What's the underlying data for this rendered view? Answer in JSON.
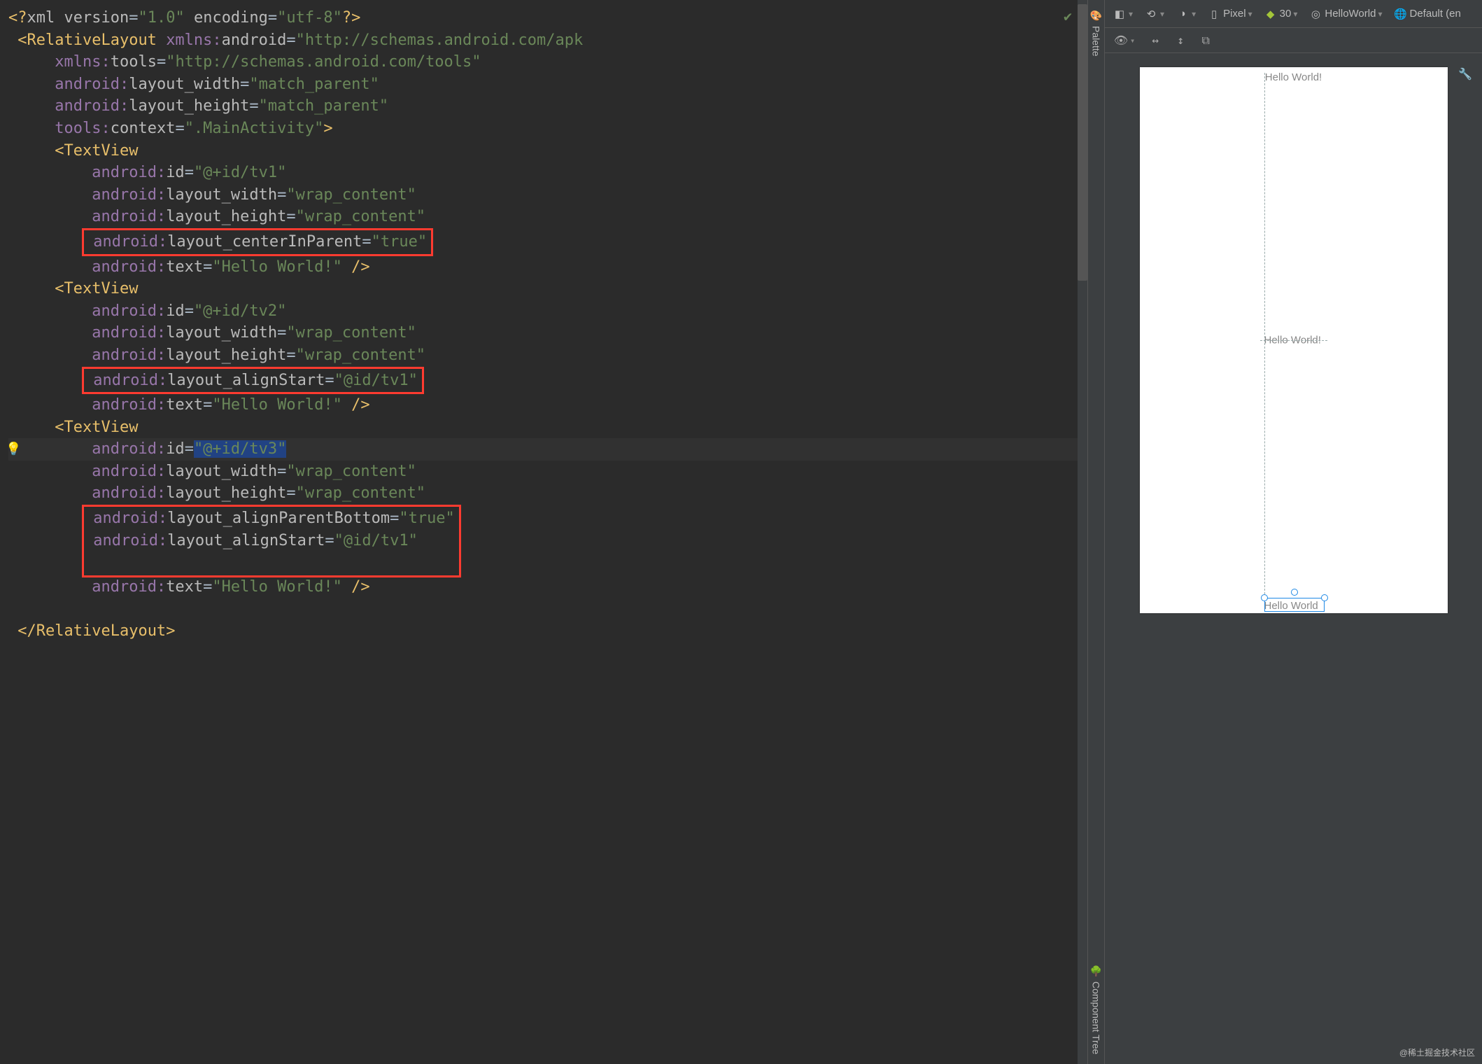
{
  "code": {
    "l1": {
      "pi_open": "<?",
      "pi_name": "xml",
      "attr1": "version",
      "val1": "\"1.0\"",
      "attr2": "encoding",
      "val2": "\"utf-8\"",
      "pi_close": "?>"
    },
    "l2": {
      "open": "<",
      "tag": "RelativeLayout",
      "ns": "xmlns:",
      "attr": "android",
      "val": "\"http://schemas.android.com/apk"
    },
    "l3": {
      "ns": "xmlns:",
      "attr": "tools",
      "val": "\"http://schemas.android.com/tools\""
    },
    "l4": {
      "ns": "android:",
      "attr": "layout_width",
      "val": "\"match_parent\""
    },
    "l5": {
      "ns": "android:",
      "attr": "layout_height",
      "val": "\"match_parent\""
    },
    "l6": {
      "ns": "tools:",
      "attr": "context",
      "val": "\".MainActivity\"",
      "close": ">"
    },
    "l7": {
      "open": "<",
      "tag": "TextView"
    },
    "l8": {
      "ns": "android:",
      "attr": "id",
      "val": "\"@+id/tv1\""
    },
    "l9": {
      "ns": "android:",
      "attr": "layout_width",
      "val": "\"wrap_content\""
    },
    "l10": {
      "ns": "android:",
      "attr": "layout_height",
      "val": "\"wrap_content\""
    },
    "l11": {
      "ns": "android:",
      "attr": "layout_centerInParent",
      "val": "\"true\""
    },
    "l12": {
      "ns": "android:",
      "attr": "text",
      "val": "\"Hello World!\"",
      "close": " />"
    },
    "l13": {
      "open": "<",
      "tag": "TextView"
    },
    "l14": {
      "ns": "android:",
      "attr": "id",
      "val": "\"@+id/tv2\""
    },
    "l15": {
      "ns": "android:",
      "attr": "layout_width",
      "val": "\"wrap_content\""
    },
    "l16": {
      "ns": "android:",
      "attr": "layout_height",
      "val": "\"wrap_content\""
    },
    "l17": {
      "ns": "android:",
      "attr": "layout_alignStart",
      "val": "\"@id/tv1\""
    },
    "l18": {
      "ns": "android:",
      "attr": "text",
      "val": "\"Hello World!\"",
      "close": " />"
    },
    "l19": {
      "open": "<",
      "tag": "TextView"
    },
    "l20": {
      "ns": "android:",
      "attr": "id",
      "val": "\"@+id/tv3\""
    },
    "l21": {
      "ns": "android:",
      "attr": "layout_width",
      "val": "\"wrap_content\""
    },
    "l22": {
      "ns": "android:",
      "attr": "layout_height",
      "val": "\"wrap_content\""
    },
    "l23": {
      "ns": "android:",
      "attr": "layout_alignParentBottom",
      "val": "\"true\""
    },
    "l24": {
      "ns": "android:",
      "attr": "layout_alignStart",
      "val": "\"@id/tv1\""
    },
    "l25": {
      "ns": "android:",
      "attr": "text",
      "val": "\"Hello World!\"",
      "close": " />"
    },
    "l26": "",
    "l27": {
      "open": "</",
      "tag": "RelativeLayout",
      "close": ">"
    }
  },
  "side": {
    "palette": "Palette",
    "component_tree": "Component Tree"
  },
  "toolbar": {
    "device": "Pixel",
    "api": "30",
    "theme": "HelloWorld",
    "locale": "Default (en"
  },
  "preview": {
    "tv1_text": "Hello World!",
    "tv2_text": "Hello World!",
    "tv3_text": "Hello World"
  },
  "watermark": "@稀土掘金技术社区"
}
